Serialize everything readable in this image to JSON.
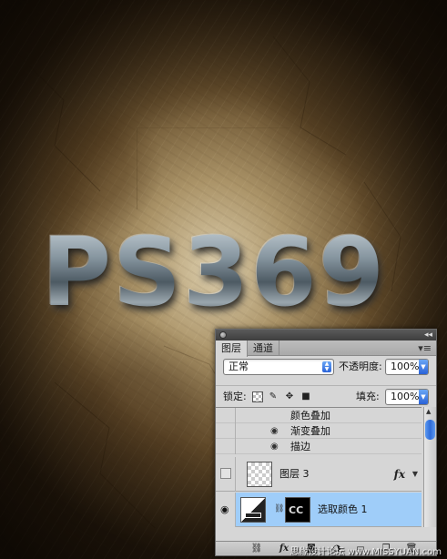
{
  "artwork": {
    "title_text": "PS369",
    "colors": {
      "paper": "#c8ac78",
      "dark_edge": "#1a130b",
      "metal": "#8796a0"
    }
  },
  "panel": {
    "tabs": [
      {
        "label": "图层",
        "active": true
      },
      {
        "label": "通道",
        "active": false
      }
    ],
    "menu_icon": "panel-menu-icon",
    "blend_mode": "正常",
    "opacity_label": "不透明度:",
    "opacity_value": "100%",
    "lock_label": "锁定:",
    "fill_label": "填充:",
    "fill_value": "100%",
    "effects": [
      {
        "name": "颜色叠加",
        "eye": false
      },
      {
        "name": "渐变叠加",
        "eye": true
      },
      {
        "name": "描边",
        "eye": true
      }
    ],
    "layers": [
      {
        "name": "图层 3",
        "visible": false,
        "has_fx": true,
        "fx_label": "fx"
      },
      {
        "name": "选取颜色 1",
        "visible": true,
        "selected": true
      }
    ],
    "bottom_icons": [
      "link-layers-icon",
      "fx-icon",
      "add-mask-icon",
      "adjustment-icon",
      "group-folder-icon",
      "new-layer-icon",
      "trash-icon"
    ],
    "bottom_fx_label": "fx"
  },
  "watermark": "思缘设计论坛 www.MISSYUAN.com"
}
